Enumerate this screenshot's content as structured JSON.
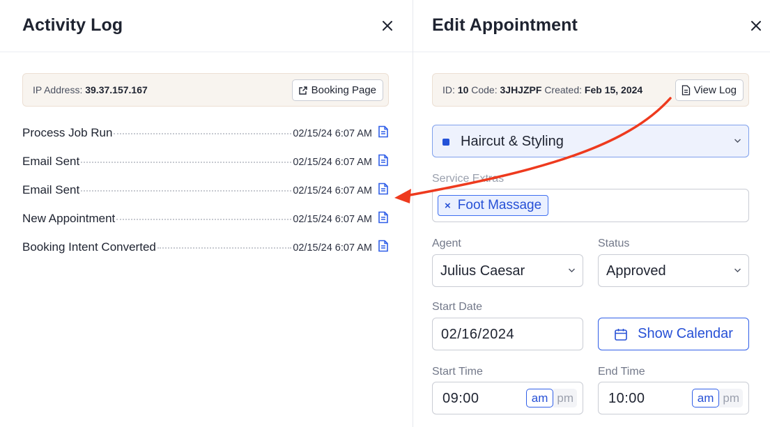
{
  "activity_log": {
    "title": "Activity Log",
    "ip_label": "IP Address:",
    "ip_value": "39.37.157.167",
    "booking_page_label": "Booking Page",
    "entries": [
      {
        "name": "Process Job Run",
        "time": "02/15/24 6:07 AM"
      },
      {
        "name": "Email Sent",
        "time": "02/15/24 6:07 AM"
      },
      {
        "name": "Email Sent",
        "time": "02/15/24 6:07 AM"
      },
      {
        "name": "New Appointment",
        "time": "02/15/24 6:07 AM"
      },
      {
        "name": "Booking Intent Converted",
        "time": "02/15/24 6:07 AM"
      }
    ]
  },
  "edit_appointment": {
    "title": "Edit Appointment",
    "meta": {
      "id_label": "ID:",
      "id_value": "10",
      "code_label": "Code:",
      "code_value": "3JHJZPF",
      "created_label": "Created:",
      "created_value": "Feb 15, 2024"
    },
    "view_log_label": "View Log",
    "service": "Haircut & Styling",
    "service_extras_label": "Service Extras",
    "service_extras": [
      "Foot Massage"
    ],
    "agent_label": "Agent",
    "agent_value": "Julius Caesar",
    "status_label": "Status",
    "status_value": "Approved",
    "start_date_label": "Start Date",
    "start_date_value": "02/16/2024",
    "show_calendar_label": "Show Calendar",
    "start_time_label": "Start Time",
    "start_time_value": "09:00",
    "end_time_label": "End Time",
    "end_time_value": "10:00",
    "am_label": "am",
    "pm_label": "pm"
  },
  "colors": {
    "accent": "#2f5ee8",
    "annotation_arrow": "#ee3a1e",
    "info_box_bg": "#f8f4ef"
  },
  "icons": {
    "close": "close-icon",
    "external_link": "external-link-icon",
    "document": "document-icon",
    "chevron_down": "chevron-down-icon",
    "calendar": "calendar-icon"
  }
}
